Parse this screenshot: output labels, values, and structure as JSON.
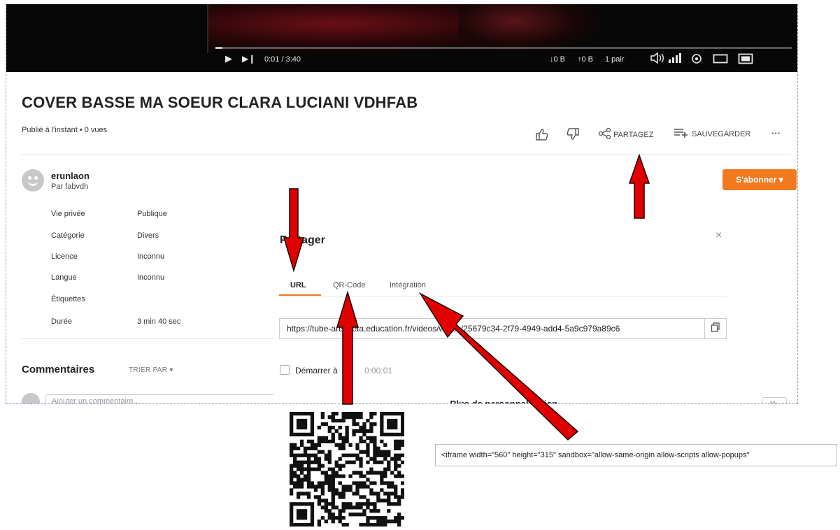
{
  "player": {
    "time": "0:01 / 3:40",
    "progress_fraction": 0.004,
    "download": "↓0 B",
    "upload": "↑0 B",
    "peers": "1 pair",
    "icons": [
      "play-icon",
      "next-icon",
      "volume-icon",
      "signal-icon",
      "settings-icon",
      "theater-icon",
      "fullscreen-icon"
    ]
  },
  "video": {
    "title": "COVER BASSE MA SOEUR CLARA LUCIANI VDHFAB",
    "meta": "Publié à l'instant • 0 vues"
  },
  "actions": {
    "share": "PARTAGEZ",
    "save": "SAUVEGARDER",
    "more": "···"
  },
  "channel": {
    "name": "erunlaon",
    "by": "Par fabvdh",
    "subscribe": "S'abonner ▾"
  },
  "info": [
    {
      "label": "Vie privée",
      "value": "Publique"
    },
    {
      "label": "Catégorie",
      "value": "Divers"
    },
    {
      "label": "Licence",
      "value": "Inconnu"
    },
    {
      "label": "Langue",
      "value": "Inconnu"
    },
    {
      "label": "Étiquettes",
      "value": ""
    },
    {
      "label": "Durée",
      "value": "3 min 40 sec"
    }
  ],
  "comments": {
    "title": "Commentaires",
    "sort": "TRIER PAR ▾",
    "placeholder": "Ajouter un commentaire...",
    "markdown_badge": "M↓"
  },
  "share_modal": {
    "title": "Partager",
    "close": "×",
    "tabs": [
      "URL",
      "QR-Code",
      "Intégration"
    ],
    "url": "https://tube-arts.beta.education.fr/videos/watch/25679c34-2f79-4949-add4-5a9c979a89c6",
    "start_label": "Démarrer à",
    "start_time": "0:00:01",
    "more": "⌄ Plus de personnalisation"
  },
  "embed_code": "<iframe width=\"560\" height=\"315\" sandbox=\"allow-same-origin allow-scripts allow-popups\"",
  "colors": {
    "accent": "#f2791e",
    "arrow": "#e00000"
  }
}
